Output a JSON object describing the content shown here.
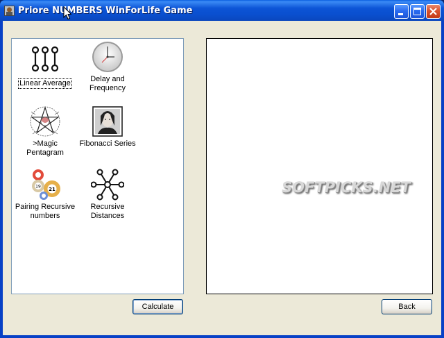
{
  "window": {
    "title": "Priore NUMBERS WinForLife Game",
    "title_color": "#0a4fcf",
    "close_color": "#c23b16"
  },
  "tools": [
    {
      "label": "Linear Average",
      "icon": "linear-average-icon",
      "focused": true
    },
    {
      "label": "Delay and Frequency",
      "icon": "clock-icon"
    },
    {
      "label": ">Magic Pentagram",
      "icon": "pentagram-icon"
    },
    {
      "label": "Fibonacci Series",
      "icon": "fibonacci-portrait-icon"
    },
    {
      "label": "Pairing Recursive numbers",
      "icon": "lottery-balls-icon"
    },
    {
      "label": "Recursive Distances",
      "icon": "network-icon"
    }
  ],
  "preview": {
    "watermark": "SOFTPICKS.NET"
  },
  "buttons": {
    "calculate": "Calculate",
    "back": "Back"
  }
}
